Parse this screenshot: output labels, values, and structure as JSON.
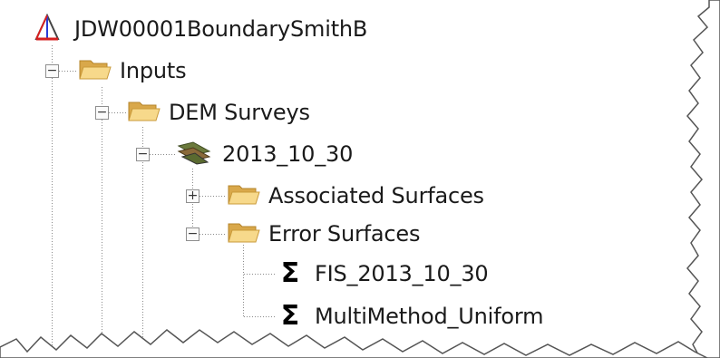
{
  "tree": {
    "root": {
      "label": "JDW00001BoundarySmithB",
      "icon": "triangle-icon"
    },
    "inputs": {
      "label": "Inputs",
      "expander": "−",
      "icon": "folder-icon"
    },
    "dem_surveys": {
      "label": "DEM Surveys",
      "expander": "−",
      "icon": "folder-icon"
    },
    "survey": {
      "label": "2013_10_30",
      "expander": "−",
      "icon": "dem-survey-icon"
    },
    "associated": {
      "label": "Associated Surfaces",
      "expander": "+",
      "icon": "folder-icon"
    },
    "error": {
      "label": "Error Surfaces",
      "expander": "−",
      "icon": "folder-icon"
    },
    "error_items": [
      {
        "label": "FIS_2013_10_30",
        "icon": "sigma-icon",
        "glyph": "Σ"
      },
      {
        "label": "MultiMethod_Uniform",
        "icon": "sigma-icon",
        "glyph": "Σ"
      }
    ]
  }
}
